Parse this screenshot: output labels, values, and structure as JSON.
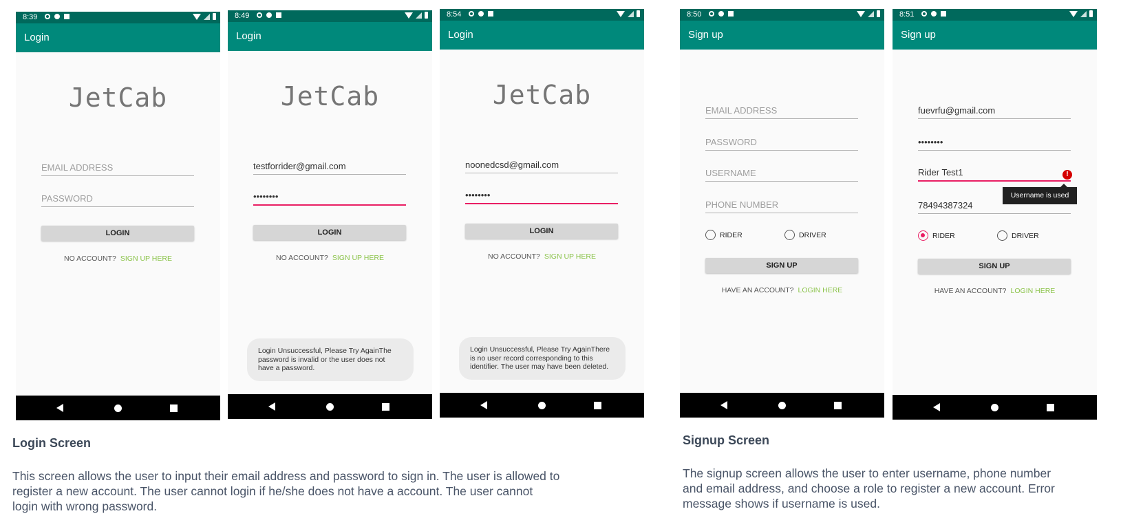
{
  "colors": {
    "status_bar": "#00695c",
    "app_bar": "#00897b",
    "link": "#8bc34a",
    "error": "#e91e63",
    "nav_bar": "#000000"
  },
  "screens": [
    {
      "status_time": "8:39",
      "title": "Login",
      "logo": "JetCab",
      "email": "EMAIL ADDRESS",
      "password": "PASSWORD",
      "button": "LOGIN",
      "prompt": "NO ACCOUNT?",
      "link": "SIGN UP HERE"
    },
    {
      "status_time": "8:49",
      "title": "Login",
      "logo": "JetCab",
      "email": "testforrider@gmail.com",
      "password": "••••••••",
      "button": "LOGIN",
      "prompt": "NO ACCOUNT?",
      "link": "SIGN UP HERE",
      "toast": "Login Unsuccessful, Please Try AgainThe password is invalid or the user does not have a password."
    },
    {
      "status_time": "8:54",
      "title": "Login",
      "logo": "JetCab",
      "email": "noonedcsd@gmail.com",
      "password": "••••••••",
      "button": "LOGIN",
      "prompt": "NO ACCOUNT?",
      "link": "SIGN UP HERE",
      "toast": "Login Unsuccessful, Please Try AgainThere is no user record corresponding to this identifier. The user may have been deleted."
    },
    {
      "status_time": "8:50",
      "title": "Sign up",
      "email": "EMAIL ADDRESS",
      "password": "PASSWORD",
      "username": "USERNAME",
      "phone": "PHONE NUMBER",
      "radio_rider": "RIDER",
      "radio_driver": "DRIVER",
      "rider_selected": false,
      "button": "SIGN UP",
      "prompt": "HAVE AN ACCOUNT?",
      "link": "LOGIN HERE"
    },
    {
      "status_time": "8:51",
      "title": "Sign up",
      "email": "fuevrfu@gmail.com",
      "password": "••••••••",
      "username": "Rider Test1",
      "phone": "78494387324",
      "error_icon": "!",
      "error_tooltip": "Username is used",
      "radio_rider": "RIDER",
      "radio_driver": "DRIVER",
      "rider_selected": true,
      "button": "SIGN UP",
      "prompt": "HAVE AN ACCOUNT?",
      "link": "LOGIN HERE"
    }
  ],
  "captions": {
    "login_title": "Login Screen",
    "login_text_1": "This screen allows the user to input their email address and password to sign in. The user is allowed to",
    "login_text_2": "register a new account. The user cannot login if he/she does not have a account. The user cannot",
    "login_text_3": "login with wrong password.",
    "signup_title": "Signup Screen",
    "signup_text_1": "The signup screen allows the user to enter username, phone number",
    "signup_text_2": "and email address, and choose a role to register a new account. Error",
    "signup_text_3": "message shows if username is used."
  },
  "icons": [
    "gear-icon",
    "shield-icon",
    "sim-icon",
    "wifi-icon",
    "signal-icon",
    "battery-icon",
    "back-icon",
    "home-icon",
    "recents-icon",
    "error-icon"
  ]
}
